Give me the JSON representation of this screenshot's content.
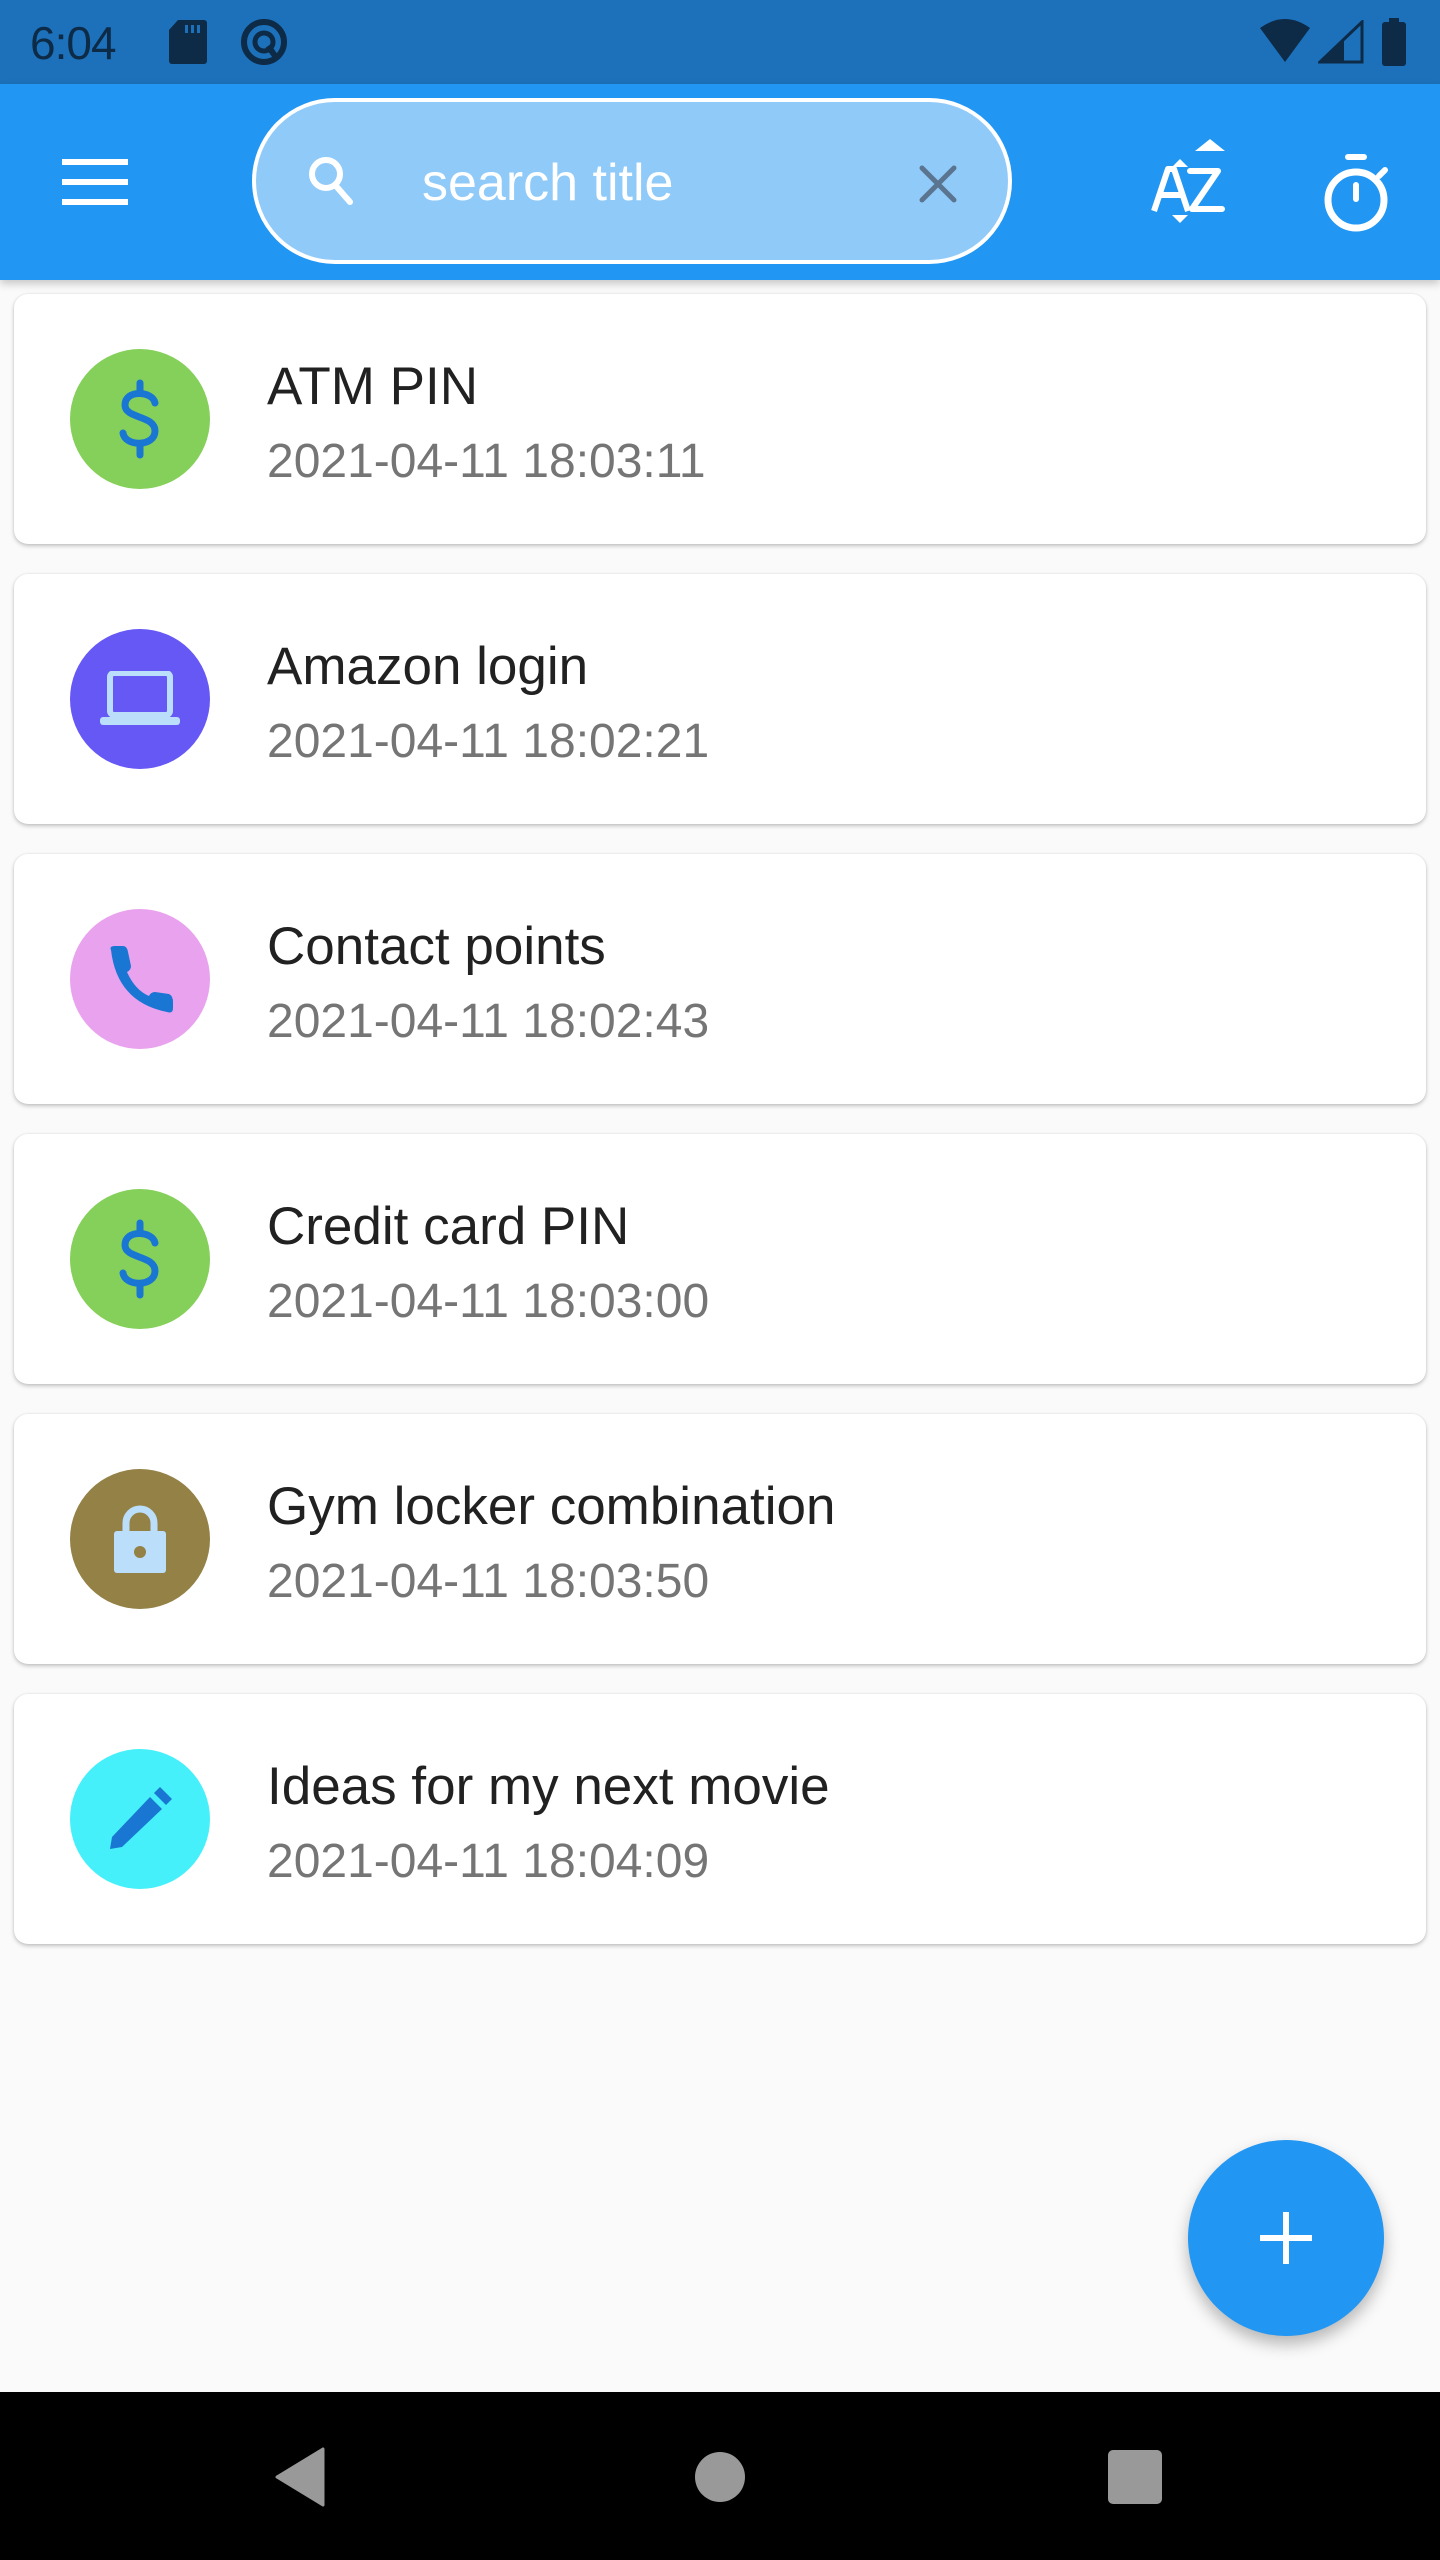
{
  "status_bar": {
    "time": "6:04",
    "icons": [
      "sd-card-icon",
      "data-saver-icon",
      "wifi-icon",
      "signal-icon",
      "battery-icon"
    ]
  },
  "app_bar": {
    "menu_icon": "menu-icon",
    "search": {
      "placeholder": "search title",
      "value": "",
      "search_icon": "search-icon",
      "clear_icon": "close-icon"
    },
    "sort_icon": "sort-alpha-icon",
    "timer_icon": "timer-icon"
  },
  "colors": {
    "status_bar": "#1c71ba",
    "app_bar": "#2196f3",
    "search_fill": "#90caf9",
    "icon_blue": "#1976d2"
  },
  "items": [
    {
      "title": "ATM PIN",
      "date": "2021-04-11 18:03:11",
      "icon": "dollar-icon",
      "color": "#85d05a"
    },
    {
      "title": "Amazon login",
      "date": "2021-04-11 18:02:21",
      "icon": "laptop-icon",
      "color": "#6558f5"
    },
    {
      "title": "Contact points",
      "date": "2021-04-11 18:02:43",
      "icon": "phone-icon",
      "color": "#e9a2ee"
    },
    {
      "title": "Credit card PIN",
      "date": "2021-04-11 18:03:00",
      "icon": "dollar-icon",
      "color": "#85d05a"
    },
    {
      "title": "Gym locker combination",
      "date": "2021-04-11 18:03:50",
      "icon": "lock-icon",
      "color": "#948146"
    },
    {
      "title": "Ideas for my next movie",
      "date": "2021-04-11 18:04:09",
      "icon": "pencil-icon",
      "color": "#45f0fa"
    }
  ],
  "fab": {
    "icon": "plus-icon"
  },
  "nav_bar": {
    "buttons": [
      "back-icon",
      "home-icon",
      "recents-icon"
    ]
  }
}
